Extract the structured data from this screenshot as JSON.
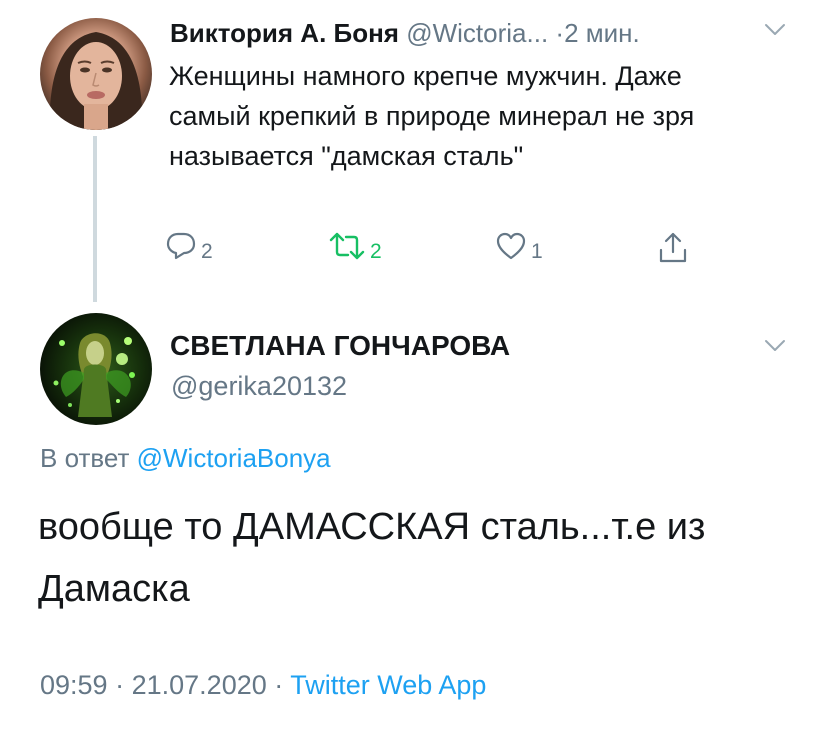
{
  "reply_tweet": {
    "author_name": "Виктория А. Боня",
    "handle": "@Wictoria...",
    "separator": "·",
    "time": "2 мин.",
    "text": "Женщины намного крепче мужчин. Даже самый крепкий в природе минерал не зря называется \"дамская сталь\"",
    "reply_count": "2",
    "retweet_count": "2",
    "like_count": "1",
    "avatar_icon": "profile-photo-woman",
    "menu_icon": "chevron-down-icon"
  },
  "main_tweet": {
    "author_name": "СВЕТЛАНА ГОНЧАРОВА",
    "handle": "@gerika20132",
    "reply_prefix": "В ответ",
    "reply_mention": "@WictoriaBonya",
    "text": "вообще то ДАМАССКАЯ сталь...т.е из Дамаска",
    "time": "09:59",
    "separator": "·",
    "date": "21.07.2020",
    "separator2": "·",
    "source": "Twitter Web App",
    "avatar_icon": "profile-photo-fantasy-fairy",
    "menu_icon": "chevron-down-icon"
  },
  "colors": {
    "text": "#14171a",
    "muted": "#657786",
    "link": "#1da1f2",
    "retweet_green": "#17bf63",
    "thread_line": "#cfd9de"
  }
}
